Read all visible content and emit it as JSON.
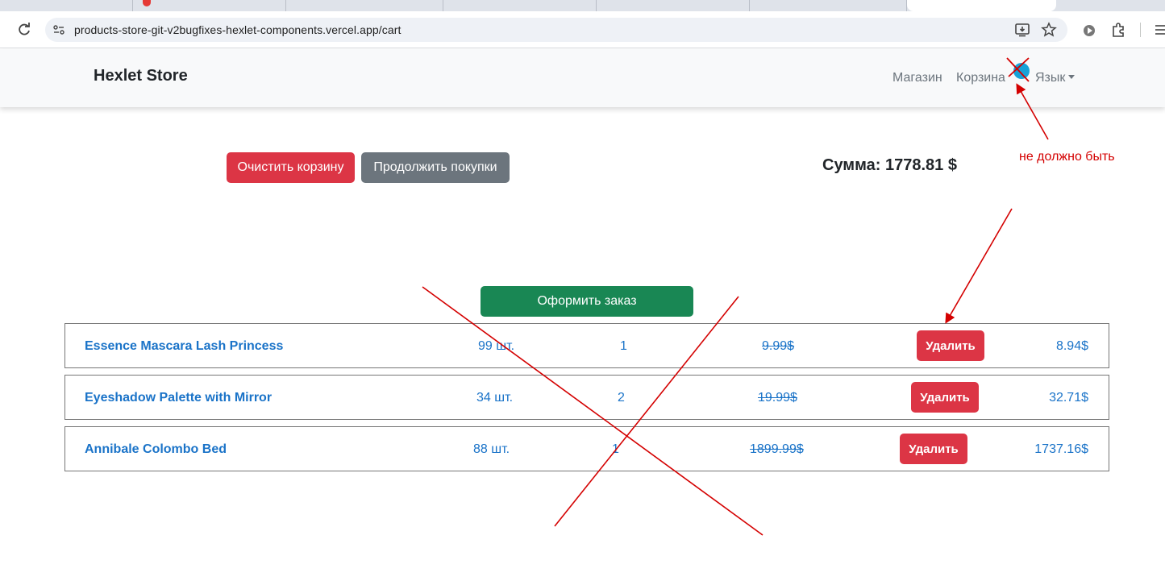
{
  "browser": {
    "url": "products-store-git-v2bugfixes-hexlet-components.vercel.app/cart"
  },
  "navbar": {
    "brand": "Hexlet Store",
    "links": {
      "shop": "Магазин",
      "cart": "Корзина",
      "language": "Язык"
    }
  },
  "cart": {
    "clear_label": "Очистить корзину",
    "continue_label": "Продолжить покупки",
    "sum_label": "Сумма: 1778.81 $",
    "checkout_label": "Оформить заказ",
    "delete_label": "Удалить",
    "items": [
      {
        "name": "Essence Mascara Lash Princess",
        "stock": "99 шт.",
        "qty": "1",
        "price": "9.99$",
        "total": "8.94$"
      },
      {
        "name": "Eyeshadow Palette with Mirror",
        "stock": "34 шт.",
        "qty": "2",
        "price": "19.99$",
        "total": "32.71$"
      },
      {
        "name": "Annibale Colombo Bed",
        "stock": "88 шт.",
        "qty": "1",
        "price": "1899.99$",
        "total": "1737.16$"
      }
    ]
  },
  "annotation": {
    "text": "не должно быть",
    "color": "#d40000"
  },
  "colors": {
    "danger": "#dc3545",
    "secondary": "#6c757d",
    "success": "#198754",
    "link": "#1a73c8"
  }
}
